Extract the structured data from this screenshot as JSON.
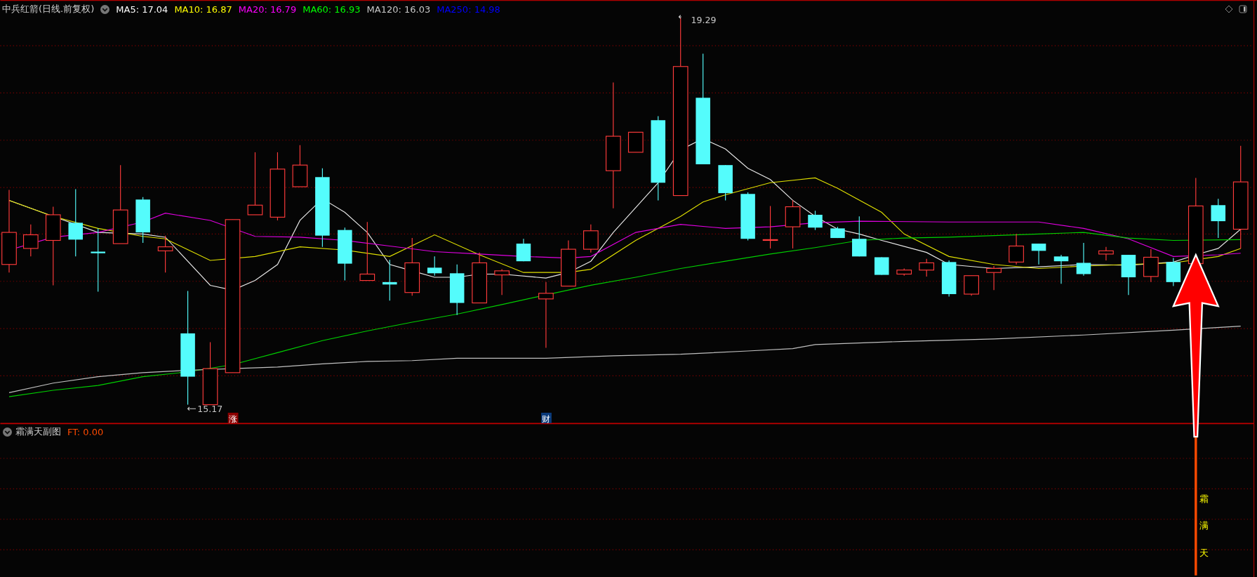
{
  "chart": {
    "title": "中兵红箭(日线.前复权)",
    "indicators": [
      {
        "label": "MA5: 17.04",
        "color": "#ffffff"
      },
      {
        "label": "MA10: 16.87",
        "color": "#ffff00"
      },
      {
        "label": "MA20: 16.79",
        "color": "#ff00ff"
      },
      {
        "label": "MA60: 16.93",
        "color": "#00ff00"
      },
      {
        "label": "MA120: 16.03",
        "color": "#c8c8c8"
      },
      {
        "label": "MA250: 14.98",
        "color": "#0000ff"
      }
    ]
  },
  "price_marks": {
    "high": "19.29",
    "low": "15.17"
  },
  "badges": [
    {
      "text": "涨",
      "kind": "rise"
    },
    {
      "text": "财",
      "kind": "finance"
    }
  ],
  "sub_chart": {
    "title": "霜满天副图",
    "reading": "FT: 0.00",
    "signal_text": "霜满天"
  }
}
